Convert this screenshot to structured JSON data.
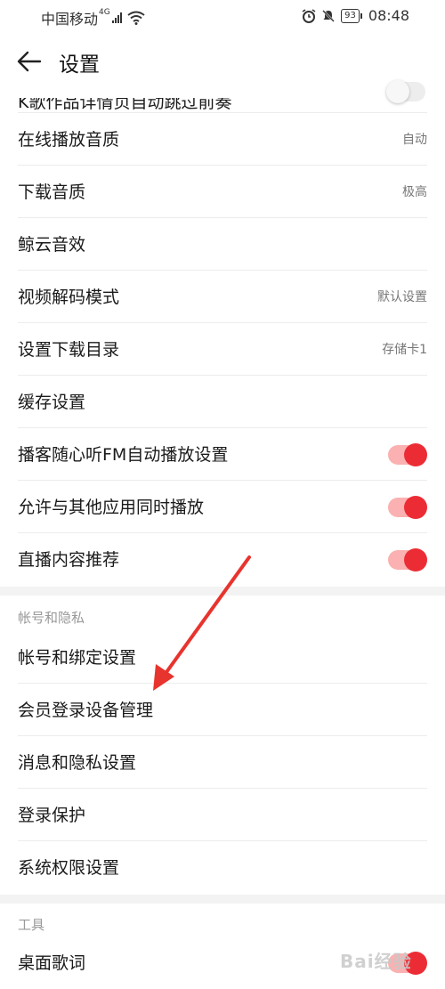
{
  "status_bar": {
    "carrier": "中国移动",
    "network": "4G",
    "battery": "93",
    "time": "08:48"
  },
  "header": {
    "title": "设置"
  },
  "rows": [
    {
      "label": "K歌作品详情页自动跳过前奏",
      "type": "toggle",
      "on": false
    },
    {
      "label": "在线播放音质",
      "value": "自动"
    },
    {
      "label": "下载音质",
      "value": "极高"
    },
    {
      "label": "鲸云音效",
      "value": ""
    },
    {
      "label": "视频解码模式",
      "value": "默认设置"
    },
    {
      "label": "设置下载目录",
      "value": "存储卡1"
    },
    {
      "label": "缓存设置",
      "value": ""
    },
    {
      "label": "播客随心听FM自动播放设置",
      "type": "toggle",
      "on": true
    },
    {
      "label": "允许与其他应用同时播放",
      "type": "toggle",
      "on": true
    },
    {
      "label": "直播内容推荐",
      "type": "toggle",
      "on": true
    }
  ],
  "section_account": {
    "title": "帐号和隐私",
    "rows": [
      {
        "label": "帐号和绑定设置"
      },
      {
        "label": "会员登录设备管理"
      },
      {
        "label": "消息和隐私设置"
      },
      {
        "label": "登录保护"
      },
      {
        "label": "系统权限设置"
      }
    ]
  },
  "section_tools": {
    "title": "工具",
    "rows": [
      {
        "label": "桌面歌词",
        "type": "toggle",
        "on": true
      }
    ]
  },
  "colors": {
    "accent": "#ec2c35",
    "annotation_arrow": "#e8342e"
  },
  "watermark": "Bai经验"
}
